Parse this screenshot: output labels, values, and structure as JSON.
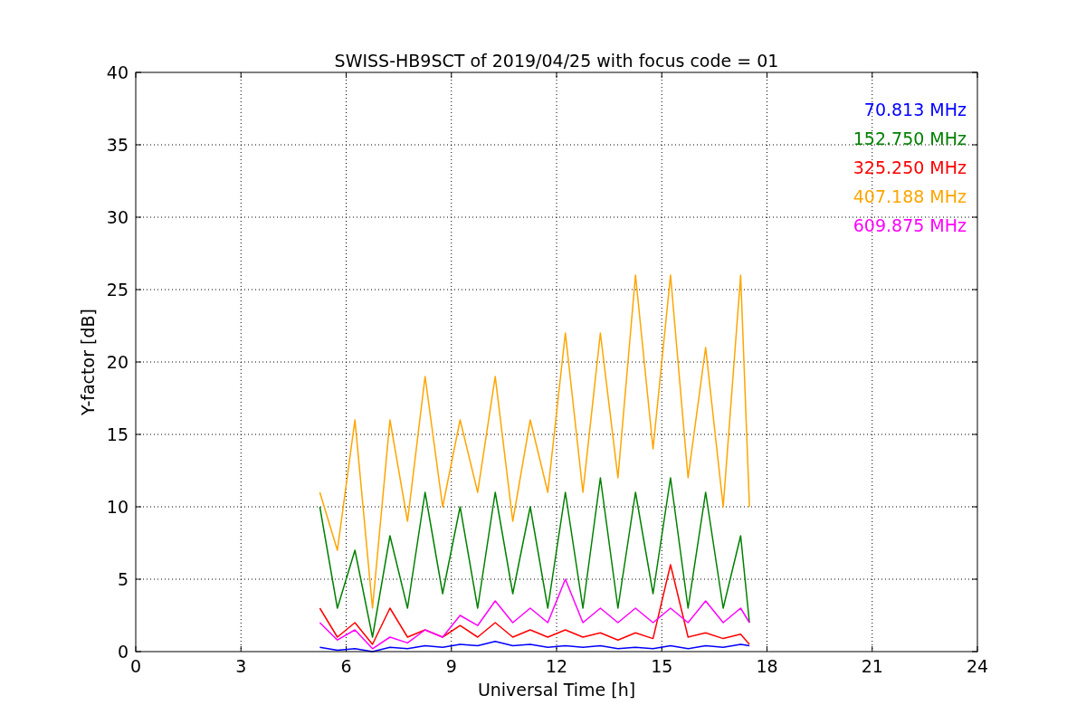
{
  "chart_data": {
    "type": "line",
    "title": "SWISS-HB9SCT of 2019/04/25 with focus code = 01",
    "xlabel": "Universal Time [h]",
    "ylabel": "Y-factor [dB]",
    "x": [
      5.25,
      5.75,
      6.25,
      6.75,
      7.25,
      7.75,
      8.25,
      8.75,
      9.25,
      9.75,
      10.25,
      10.75,
      11.25,
      11.75,
      12.25,
      12.75,
      13.25,
      13.75,
      14.25,
      14.75,
      15.25,
      15.75,
      16.25,
      16.75,
      17.25,
      17.5
    ],
    "series": [
      {
        "name": "70.813 MHz",
        "color": "#0000ff",
        "values": [
          0.3,
          0.1,
          0.2,
          0,
          0.3,
          0.2,
          0.4,
          0.3,
          0.5,
          0.4,
          0.7,
          0.4,
          0.5,
          0.3,
          0.4,
          0.3,
          0.4,
          0.2,
          0.3,
          0.2,
          0.4,
          0.2,
          0.4,
          0.3,
          0.5,
          0.4
        ]
      },
      {
        "name": "152.750 MHz",
        "color": "#008000",
        "values": [
          10,
          3,
          7,
          1,
          8,
          3,
          11,
          4,
          10,
          3,
          11,
          4,
          10,
          3,
          11,
          3,
          12,
          3,
          11,
          4,
          12,
          3,
          11,
          3,
          8,
          2
        ]
      },
      {
        "name": "325.250 MHz",
        "color": "#ff0000",
        "values": [
          3,
          1,
          2,
          0.5,
          3,
          1,
          1.5,
          1,
          1.8,
          1,
          2,
          1,
          1.5,
          1,
          1.5,
          1,
          1.3,
          0.8,
          1.3,
          0.9,
          6,
          1,
          1.3,
          0.9,
          1.2,
          0.5
        ]
      },
      {
        "name": "407.188 MHz",
        "color": "#ffa500",
        "values": [
          11,
          7,
          16,
          3,
          16,
          9,
          19,
          10,
          16,
          11,
          19,
          9,
          16,
          11,
          22,
          11,
          22,
          12,
          26,
          14,
          26,
          12,
          21,
          10,
          26,
          10
        ]
      },
      {
        "name": "609.875 MHz",
        "color": "#ff00ff",
        "values": [
          2,
          0.8,
          1.5,
          0.2,
          1,
          0.6,
          1.5,
          1,
          2.5,
          1.8,
          3.5,
          2,
          3,
          2,
          5,
          2,
          3,
          2,
          3,
          2,
          3,
          2,
          3.5,
          2,
          3,
          2
        ]
      }
    ],
    "grid": true,
    "xlim": [
      0,
      24
    ],
    "ylim": [
      0,
      40
    ],
    "xticks": [
      0,
      3,
      6,
      9,
      12,
      15,
      18,
      21,
      24
    ],
    "yticks": [
      0,
      5,
      10,
      15,
      20,
      25,
      30,
      35,
      40
    ]
  }
}
